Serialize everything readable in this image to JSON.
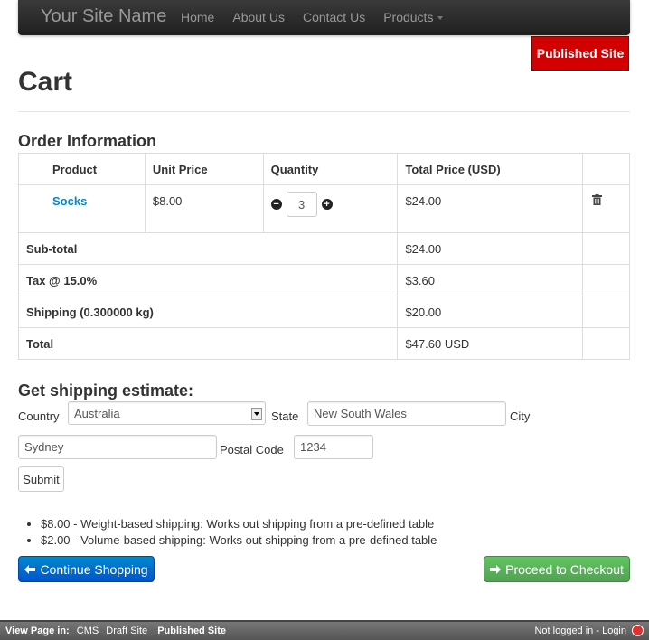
{
  "navbar": {
    "brand": "Your Site Name",
    "items": [
      {
        "label": "Home"
      },
      {
        "label": "About Us"
      },
      {
        "label": "Contact Us"
      },
      {
        "label": "Products"
      }
    ]
  },
  "badge": "Published Site",
  "page_title": "Cart",
  "order": {
    "heading": "Order Information",
    "columns": [
      "Product",
      "Unit Price",
      "Quantity",
      "Total Price (USD)"
    ],
    "items": [
      {
        "product": "Socks",
        "unit_price": "$8.00",
        "quantity": "3",
        "total": "$24.00"
      }
    ],
    "summary": [
      {
        "label": "Sub-total",
        "value": "$24.00"
      },
      {
        "label": "Tax @ 15.0%",
        "value": "$3.60"
      },
      {
        "label": "Shipping (0.300000 kg)",
        "value": "$20.00"
      },
      {
        "label": "Total",
        "value": "$47.60 USD"
      }
    ]
  },
  "shipping": {
    "heading": "Get shipping estimate:",
    "country_label": "Country",
    "country_value": "Australia",
    "state_label": "State",
    "state_value": "New South Wales",
    "city_label": "City",
    "city_value": "Sydney",
    "postal_label": "Postal Code",
    "postal_value": "1234",
    "submit_label": "Submit",
    "rates": [
      "$8.00 - Weight-based shipping: Works out shipping from a pre-defined table",
      "$2.00 - Volume-based shipping: Works out shipping from a pre-defined table"
    ]
  },
  "actions": {
    "continue_label": "Continue Shopping",
    "checkout_label": "Proceed to Checkout"
  },
  "footer": {
    "view_in": "View Page in:",
    "cms": "CMS",
    "draft": "Draft Site",
    "published": "Published Site",
    "login_status": "Not logged in - ",
    "login": "Login"
  },
  "colors": {
    "badge": "#d20000",
    "link": "#0088cc",
    "primary": "#0066cc",
    "success": "#5bb75b"
  }
}
